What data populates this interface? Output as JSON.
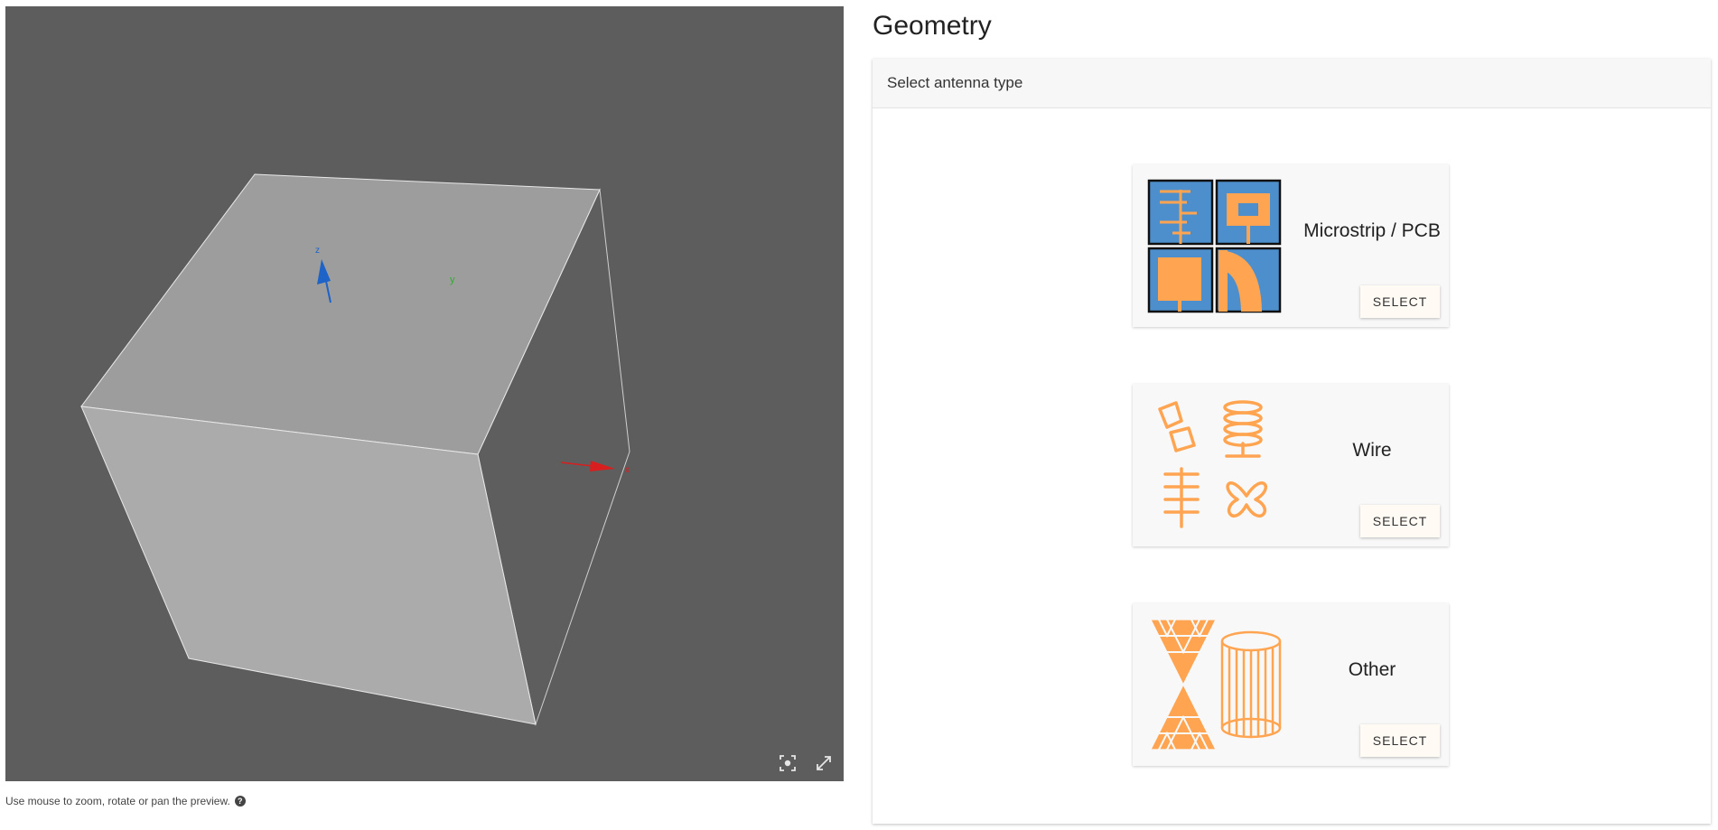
{
  "viewer": {
    "hint": "Use mouse to zoom, rotate or pan the preview.",
    "axes": {
      "x": "x",
      "y": "y",
      "z": "z"
    },
    "icons": {
      "recenter": "focus-target-icon",
      "fullscreen": "expand-arrows-icon",
      "help": "question-circle-icon"
    }
  },
  "geometry": {
    "title": "Geometry",
    "panel_header": "Select antenna type",
    "options": [
      {
        "label": "Microstrip / PCB",
        "button": "SELECT",
        "icon": "microstrip-pcb-icon"
      },
      {
        "label": "Wire",
        "button": "SELECT",
        "icon": "wire-antennas-icon"
      },
      {
        "label": "Other",
        "button": "SELECT",
        "icon": "fractal-cylinder-icon"
      }
    ]
  },
  "colors": {
    "accent_orange": "#ffa552",
    "pcb_blue": "#4d8fcc",
    "viewport_bg": "#5d5d5d"
  }
}
